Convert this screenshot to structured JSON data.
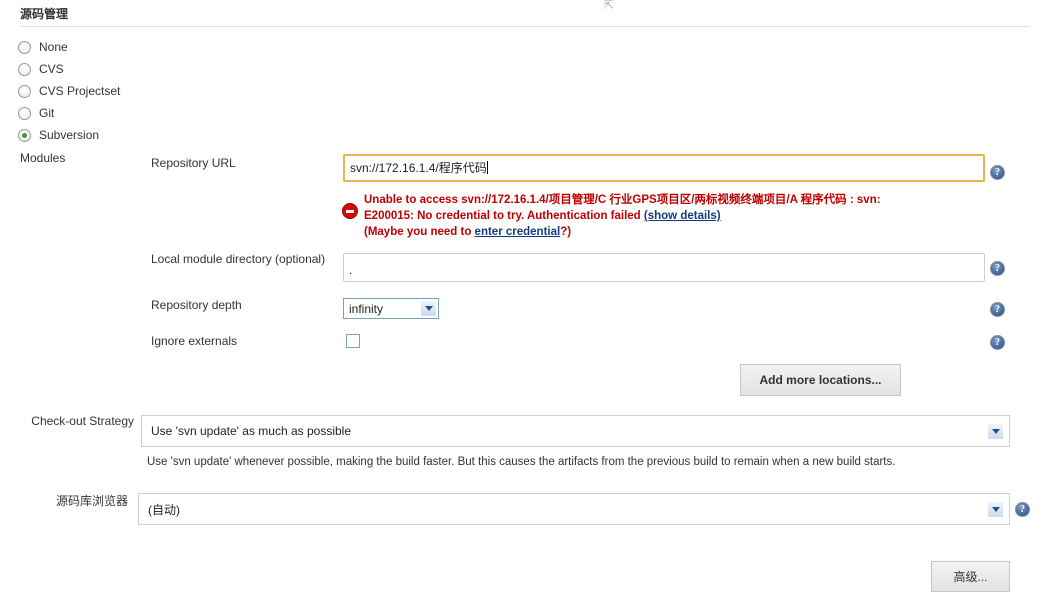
{
  "section": {
    "title": "源码管理"
  },
  "scm_options": [
    {
      "label": "None",
      "selected": false
    },
    {
      "label": "CVS",
      "selected": false
    },
    {
      "label": "CVS Projectset",
      "selected": false
    },
    {
      "label": "Git",
      "selected": false
    },
    {
      "label": "Subversion",
      "selected": true
    }
  ],
  "modules_label": "Modules",
  "fields": {
    "repository_url": {
      "label": "Repository URL",
      "value": "svn://172.16.1.4/程序代码"
    },
    "local_module_directory": {
      "label": "Local module directory (optional)",
      "value": "."
    },
    "repository_depth": {
      "label": "Repository depth",
      "value": "infinity"
    },
    "ignore_externals": {
      "label": "Ignore externals",
      "checked": false
    }
  },
  "error": {
    "line1": "Unable to access svn://172.16.1.4/项目管理/C 行业GPS项目区/两标视频终端项目/A 程序代码 : svn:",
    "line2_prefix": "E200015: No credential to try. Authentication failed ",
    "line2_link": "(show details)",
    "line3_prefix": "(Maybe you need to ",
    "line3_link": "enter credential",
    "line3_suffix": "?)"
  },
  "buttons": {
    "add_more_locations": "Add more locations...",
    "advanced": "高级..."
  },
  "checkout_strategy": {
    "label": "Check-out Strategy",
    "value": "Use 'svn update' as much as possible",
    "description": "Use 'svn update' whenever possible, making the build faster. But this causes the artifacts from the previous build to remain when a new build starts."
  },
  "repository_browser": {
    "label": "源码库浏览器",
    "value": "(自动)"
  },
  "help_icon_glyph": "?",
  "colors": {
    "accent_focus_border": "#e8b54d",
    "error_red": "#c00000",
    "link_blue": "#143a80",
    "radio_selected_green": "#3a9c2e"
  }
}
